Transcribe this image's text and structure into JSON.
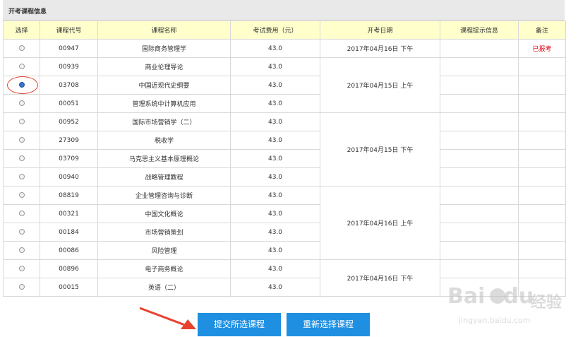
{
  "panel": {
    "title": "开考课程信息"
  },
  "table": {
    "headers": {
      "select": "选择",
      "code": "课程代号",
      "name": "课程名称",
      "fee": "考试费用（元）",
      "date": "开考日期",
      "hint": "课程提示信息",
      "remark": "备注"
    },
    "rows": [
      {
        "code": "00947",
        "name": "国际商务管理学",
        "fee": "43.0",
        "date": "2017年04月16日 下午",
        "remark": "已报考",
        "checked": false
      },
      {
        "code": "00939",
        "name": "商业伦理导论",
        "fee": "43.0",
        "date": "2017年04月15日 上午",
        "remark": "",
        "checked": false
      },
      {
        "code": "03708",
        "name": "中国近现代史纲要",
        "fee": "43.0",
        "remark": "",
        "checked": true
      },
      {
        "code": "00051",
        "name": "管理系统中计算机应用",
        "fee": "43.0",
        "remark": "",
        "checked": false
      },
      {
        "code": "00952",
        "name": "国际市场营销学（二）",
        "fee": "43.0",
        "date": "2017年04月15日 下午",
        "remark": "",
        "checked": false
      },
      {
        "code": "27309",
        "name": "税收学",
        "fee": "43.0",
        "remark": "",
        "checked": false
      },
      {
        "code": "03709",
        "name": "马克思主义基本原理概论",
        "fee": "43.0",
        "remark": "",
        "checked": false
      },
      {
        "code": "00940",
        "name": "战略管理教程",
        "fee": "43.0",
        "remark": "",
        "checked": false
      },
      {
        "code": "08819",
        "name": "企业管理咨询与诊断",
        "fee": "43.0",
        "date": "2017年04月16日 上午",
        "remark": "",
        "checked": false
      },
      {
        "code": "00321",
        "name": "中国文化概论",
        "fee": "43.0",
        "remark": "",
        "checked": false
      },
      {
        "code": "00184",
        "name": "市场营销策划",
        "fee": "43.0",
        "remark": "",
        "checked": false
      },
      {
        "code": "00086",
        "name": "风险管理",
        "fee": "43.0",
        "remark": "",
        "checked": false
      },
      {
        "code": "00896",
        "name": "电子商务概论",
        "fee": "43.0",
        "date": "2017年04月16日 下午",
        "remark": "",
        "checked": false
      },
      {
        "code": "00015",
        "name": "英语（二）",
        "fee": "43.0",
        "remark": "",
        "checked": false
      }
    ]
  },
  "buttons": {
    "submit": "提交所选课程",
    "reset": "重新选择课程"
  },
  "colors": {
    "header_bg": "#ffffcc",
    "button_bg": "#1e8fe1",
    "remark_red": "#e60012",
    "annotation_red": "#e8412e"
  },
  "watermark": {
    "brand_a": "Bai",
    "brand_b": "du",
    "brand_c": "经验",
    "url": "jingyan.baidu.com"
  }
}
